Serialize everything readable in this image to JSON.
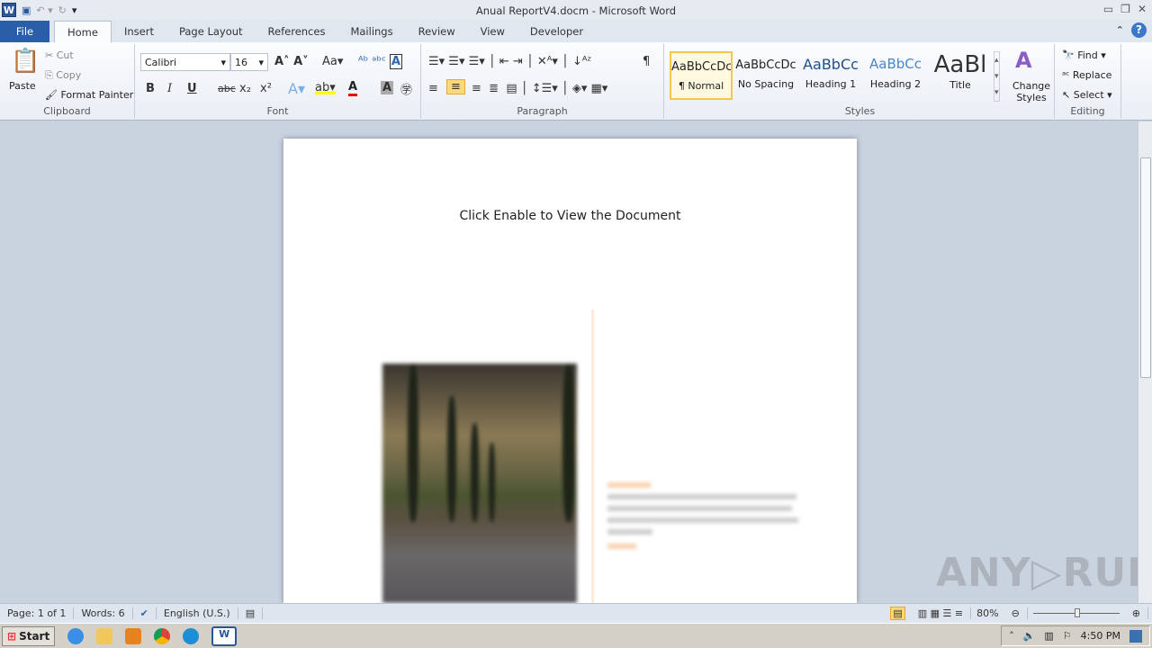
{
  "window": {
    "title": "Anual ReportV4.docm - Microsoft Word",
    "app_icon": "W"
  },
  "tabs": [
    {
      "label": "File"
    },
    {
      "label": "Home"
    },
    {
      "label": "Insert"
    },
    {
      "label": "Page Layout"
    },
    {
      "label": "References"
    },
    {
      "label": "Mailings"
    },
    {
      "label": "Review"
    },
    {
      "label": "View"
    },
    {
      "label": "Developer"
    }
  ],
  "clipboard": {
    "paste": "Paste",
    "cut": "Cut",
    "copy": "Copy",
    "format_painter": "Format Painter",
    "label": "Clipboard"
  },
  "font": {
    "name": "Calibri",
    "size": "16",
    "label": "Font",
    "bold": "B",
    "italic": "I",
    "underline": "U",
    "strike": "abc",
    "sub": "x₂",
    "sup": "x²",
    "grow": "A",
    "case": "Aa"
  },
  "paragraph": {
    "label": "Paragraph",
    "pilcrow": "¶"
  },
  "styles": {
    "label": "Styles",
    "items": [
      {
        "sample": "AaBbCcDc",
        "name": "¶ Normal"
      },
      {
        "sample": "AaBbCcDc",
        "name": "No Spacing"
      },
      {
        "sample": "AaBbCc",
        "name": "Heading 1"
      },
      {
        "sample": "AaBbCc",
        "name": "Heading 2"
      },
      {
        "sample": "AaBl",
        "name": "Title"
      }
    ],
    "change_styles": "Change Styles"
  },
  "editing": {
    "label": "Editing",
    "find": "Find",
    "replace": "Replace",
    "select": "Select"
  },
  "document": {
    "message": "Click Enable to View the Document"
  },
  "status": {
    "page": "Page: 1 of 1",
    "words": "Words: 6",
    "language": "English (U.S.)",
    "zoom": "80%",
    "zoom_percent": 80
  },
  "taskbar": {
    "start": "Start",
    "time": "4:50 PM"
  },
  "watermark": "ANY RUN"
}
